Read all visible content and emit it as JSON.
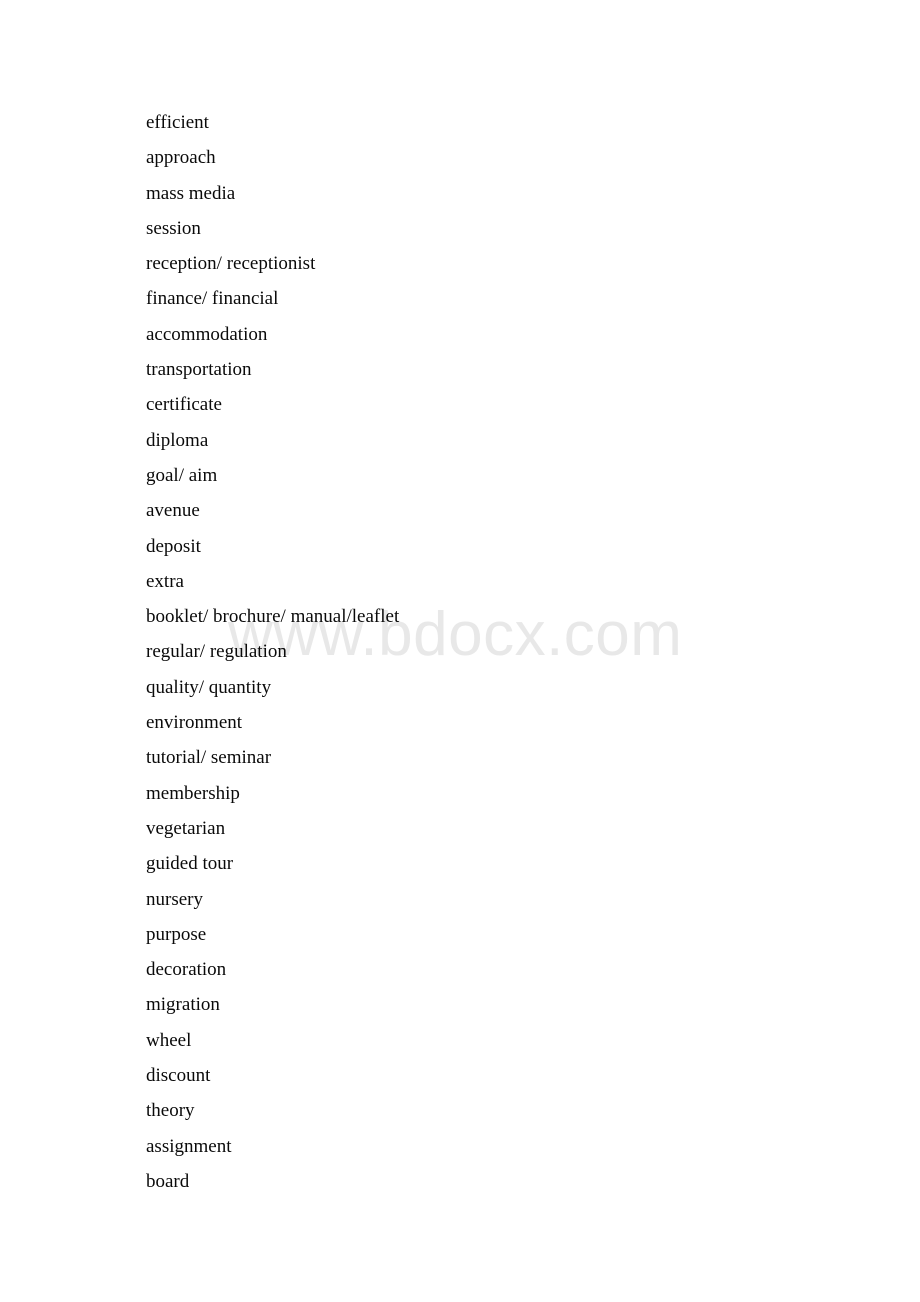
{
  "document": {
    "watermark": "www.bdocx.com",
    "words": [
      "efficient",
      "approach",
      "mass media",
      "session",
      "reception/ receptionist",
      "finance/ financial",
      "accommodation",
      "transportation",
      "certificate",
      "diploma",
      "goal/ aim",
      "avenue",
      "deposit",
      "extra",
      "booklet/ brochure/ manual/leaflet",
      "regular/ regulation",
      "quality/ quantity",
      "environment",
      "tutorial/ seminar",
      "membership",
      "vegetarian",
      "guided tour",
      "nursery",
      "purpose",
      "decoration",
      "migration",
      "wheel",
      "discount",
      "theory",
      "assignment",
      "board"
    ]
  }
}
